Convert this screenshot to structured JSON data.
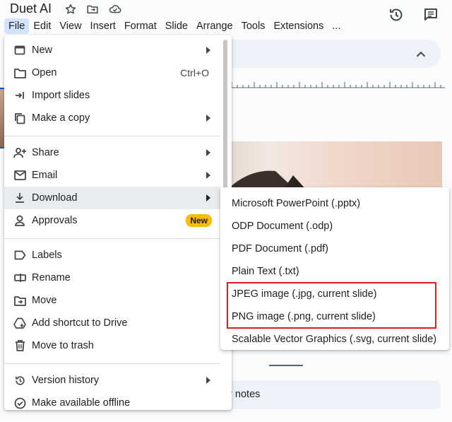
{
  "app": {
    "title": "Duet AI"
  },
  "menubar": {
    "items": [
      "File",
      "Edit",
      "View",
      "Insert",
      "Format",
      "Slide",
      "Arrange",
      "Tools",
      "Extensions",
      "..."
    ]
  },
  "file_menu": {
    "items": [
      {
        "label": "New",
        "icon": "slides-icon",
        "submenu": true
      },
      {
        "label": "Open",
        "icon": "folder-icon",
        "shortcut": "Ctrl+O"
      },
      {
        "label": "Import slides",
        "icon": "import-icon"
      },
      {
        "label": "Make a copy",
        "icon": "copy-icon",
        "submenu": true
      },
      {
        "label": "Share",
        "icon": "person-add-icon",
        "submenu": true
      },
      {
        "label": "Email",
        "icon": "email-icon",
        "submenu": true
      },
      {
        "label": "Download",
        "icon": "download-icon",
        "submenu": true
      },
      {
        "label": "Approvals",
        "icon": "approvals-icon",
        "badge": "New"
      },
      {
        "label": "Labels",
        "icon": "label-icon"
      },
      {
        "label": "Rename",
        "icon": "rename-icon"
      },
      {
        "label": "Move",
        "icon": "move-icon"
      },
      {
        "label": "Add shortcut to Drive",
        "icon": "drive-shortcut-icon"
      },
      {
        "label": "Move to trash",
        "icon": "trash-icon"
      },
      {
        "label": "Version history",
        "icon": "history-icon",
        "submenu": true
      },
      {
        "label": "Make available offline",
        "icon": "offline-icon"
      }
    ]
  },
  "download_submenu": {
    "items": [
      "Microsoft PowerPoint (.pptx)",
      "ODP Document (.odp)",
      "PDF Document (.pdf)",
      "Plain Text (.txt)",
      "JPEG image (.jpg, current slide)",
      "PNG image (.png, current slide)",
      "Scalable Vector Graphics (.svg, current slide)"
    ]
  },
  "notes": {
    "text": "er notes"
  },
  "colors": {
    "accent": "#0b57d0",
    "badge": "#fbbc04",
    "highlight": "#e21c1c"
  }
}
